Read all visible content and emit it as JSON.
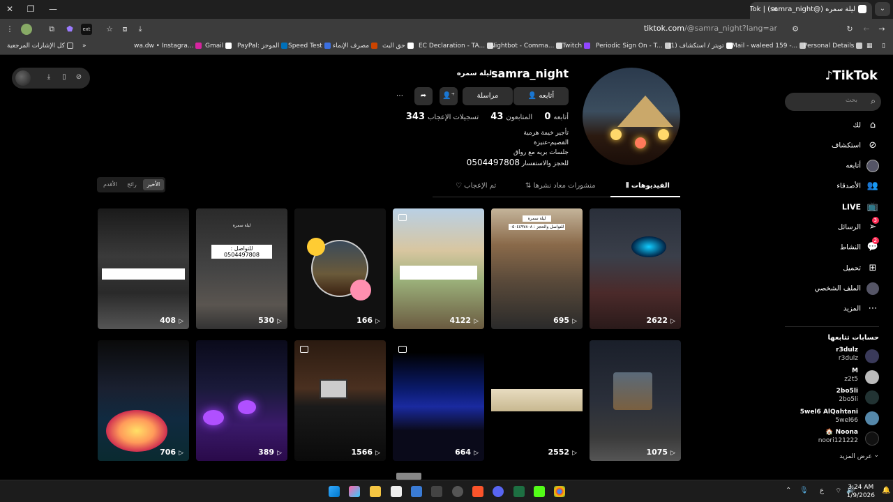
{
  "browser": {
    "tab_title": "ليلة سمره (@samra_night) | TikTok",
    "url_host": "tiktok.com",
    "url_path": "/@samra_night?lang=ar",
    "bookmarks": [
      "كل الإشارات المرجعية",
      "wa.dw • Instagra...",
      "Gmail",
      "PayPal: الموجز",
      "Speed Test",
      "مصرف الإنماء",
      "حق البث",
      "EC Declaration - TA...",
      "Nightbot - Comma...",
      "Twitch",
      "Periodic Sign On - T...",
      "(1) تويتر / استكشاف",
      "Mail - waleed 159 -...",
      "Personal Details"
    ]
  },
  "nav": {
    "logo": "TikTok",
    "search_placeholder": "بحث",
    "items": [
      {
        "label": "لك",
        "icon": "home-icon"
      },
      {
        "label": "استكشاف",
        "icon": "compass-icon"
      },
      {
        "label": "أتابعه",
        "icon": "avatar-icon"
      },
      {
        "label": "الأصدقاء",
        "icon": "friends-icon"
      },
      {
        "label": "LIVE",
        "icon": "live-icon"
      },
      {
        "label": "الرسائل",
        "icon": "messages-icon",
        "badge": "3"
      },
      {
        "label": "النشاط",
        "icon": "activity-icon",
        "badge": "2"
      },
      {
        "label": "تحميل",
        "icon": "upload-icon"
      },
      {
        "label": "الملف الشخصي",
        "icon": "profile-icon"
      },
      {
        "label": "المزيد",
        "icon": "more-icon"
      }
    ],
    "following_title": "حسابات تتابعها",
    "following": [
      {
        "name": "r3dulz",
        "user": "r3dulz"
      },
      {
        "name": "M",
        "user": "z2t5"
      },
      {
        "name": "2bo5li",
        "user": "2bo5li"
      },
      {
        "name": "5wel6 AlQahtani",
        "user": "5wel66"
      },
      {
        "name": "🏠 Noona",
        "user": "noori121222"
      }
    ],
    "see_more": "عرض المزيد"
  },
  "profile": {
    "username": "samra_night",
    "nickname": "ليلة سمره",
    "follow_label": "أتابعه",
    "message_label": "مراسلة",
    "stats": {
      "following_label": "أتابعه",
      "following": "0",
      "followers_label": "المتابعون",
      "followers": "43",
      "likes_label": "تسجيلات الإعجاب",
      "likes": "343"
    },
    "bio": [
      "تأجير خيمة هرمية",
      "القصيم-عنيزة",
      "جلسات بريه مع رواق",
      "للحجز والاستفسار"
    ],
    "phone": "0504497808"
  },
  "tabs": {
    "videos": "الفيديوهات",
    "reposts": "منشورات معاد نشرها",
    "liked": "تم الإعجاب",
    "sort": [
      "الأخير",
      "رائج",
      "الأقدم"
    ]
  },
  "videos": [
    {
      "views": "2622"
    },
    {
      "views": "695"
    },
    {
      "views": "4122"
    },
    {
      "views": "166"
    },
    {
      "views": "530"
    },
    {
      "views": "408"
    },
    {
      "views": "1075"
    },
    {
      "views": "2552"
    },
    {
      "views": "664"
    },
    {
      "views": "1566"
    },
    {
      "views": "389"
    },
    {
      "views": "706"
    }
  ],
  "video_texts": {
    "v5_title": "ليلة سمره",
    "v5_phone": "للتواصل : 0504497808",
    "v2_title": "ليلة سمره",
    "v2_phone": "للتواصل والحجز : ٠٥٠٤٤٩٧٨٠٨"
  },
  "taskbar": {
    "time": "3:24 AM",
    "date": "1/9/2026",
    "lang": "ع"
  }
}
